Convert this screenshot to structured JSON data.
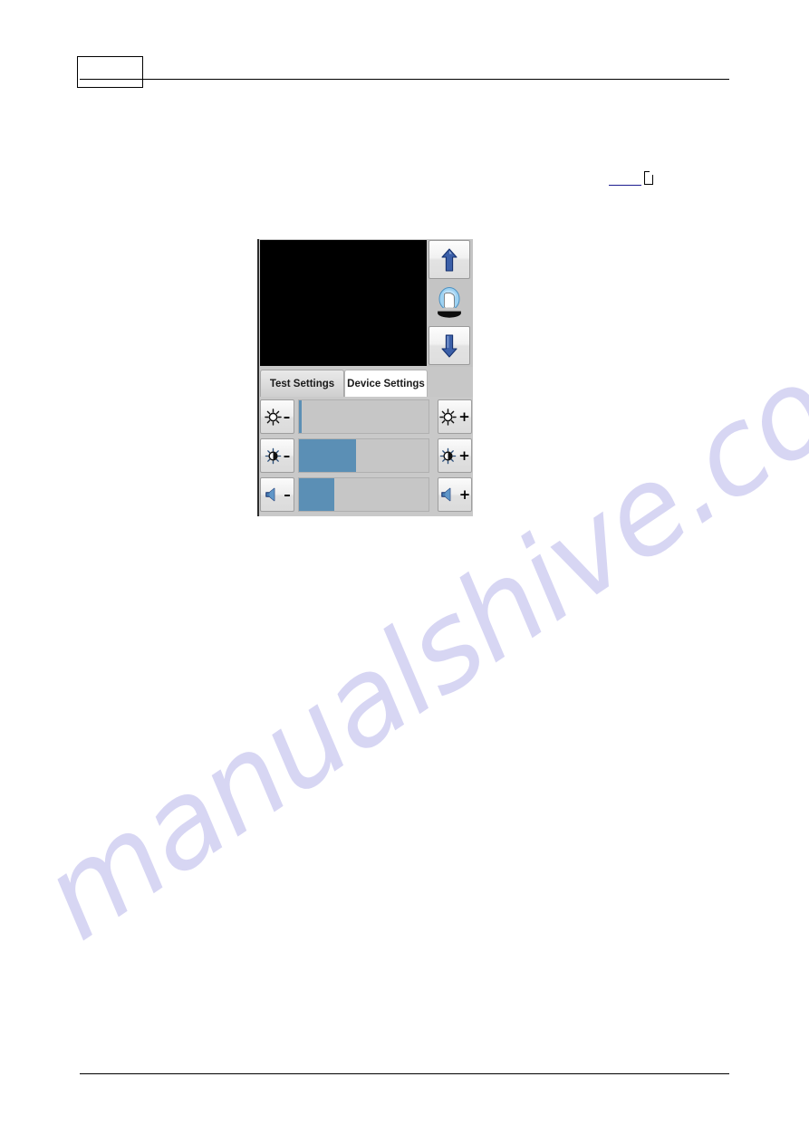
{
  "page": {
    "header_box_text": "",
    "watermark_text": "manualshive.com",
    "cross_reference": {
      "link_text": "",
      "glyph_name": "missing-glyph-tofu"
    }
  },
  "device": {
    "screen": {
      "name": "video-preview",
      "content": "",
      "background_color": "#000000"
    },
    "side_buttons": [
      {
        "name": "move-up-button",
        "icon": "arrow-up-icon",
        "label": ""
      },
      {
        "name": "head-position-button",
        "icon": "head-chinrest-icon",
        "label": ""
      },
      {
        "name": "move-down-button",
        "icon": "arrow-down-icon",
        "label": ""
      }
    ],
    "tabs": [
      {
        "id": "test-settings",
        "label": "Test Settings",
        "active": false
      },
      {
        "id": "device-settings",
        "label": "Device Settings",
        "active": true
      }
    ],
    "settings_rows": [
      {
        "id": "brightness",
        "decrease_icon": "sun-brightness-icon",
        "increase_icon": "sun-brightness-icon",
        "decrease_label": "–",
        "increase_label": "+",
        "value_percent": 2
      },
      {
        "id": "contrast",
        "decrease_icon": "contrast-half-sun-icon",
        "increase_icon": "contrast-half-sun-icon",
        "decrease_label": "–",
        "increase_label": "+",
        "value_percent": 44
      },
      {
        "id": "volume",
        "decrease_icon": "speaker-volume-icon",
        "increase_icon": "speaker-volume-icon",
        "decrease_label": "–",
        "increase_label": "+",
        "value_percent": 27
      }
    ],
    "colors": {
      "slider_fill": "#5b8fb5",
      "slider_track": "#c6c6c6",
      "panel_background": "#c9c9c9",
      "active_tab_background": "#ffffff",
      "link_blue": "#1b1b8f",
      "watermark": "#c9c7ef"
    }
  }
}
